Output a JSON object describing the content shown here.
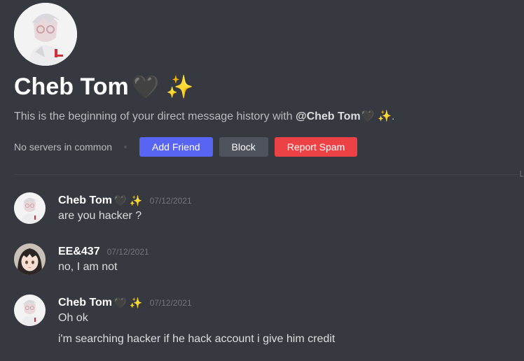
{
  "profile": {
    "display_name": "Cheb Tom",
    "display_emoji": "🖤 ✨",
    "intro_prefix": "This is the beginning of your direct message history with ",
    "intro_handle": "@Cheb Tom🖤 ✨",
    "intro_suffix": ".",
    "mutual_servers": "No servers in common"
  },
  "actions": {
    "add_friend": "Add Friend",
    "block": "Block",
    "report_spam": "Report Spam"
  },
  "colors": {
    "background": "#36393f",
    "add_friend": "#5865f2",
    "block": "#4f545c",
    "report_spam": "#ed4245"
  },
  "messages": [
    {
      "author": "Cheb Tom",
      "author_emoji": "🖤 ✨",
      "timestamp": "07/12/2021",
      "lines": [
        "are you hacker ?"
      ]
    },
    {
      "author": "EE&437",
      "author_emoji": "",
      "timestamp": "07/12/2021",
      "lines": [
        "no, I am not"
      ]
    },
    {
      "author": "Cheb Tom",
      "author_emoji": "🖤 ✨",
      "timestamp": "07/12/2021",
      "lines": [
        "Oh ok",
        "i'm searching hacker if he hack account i give him credit"
      ]
    }
  ]
}
